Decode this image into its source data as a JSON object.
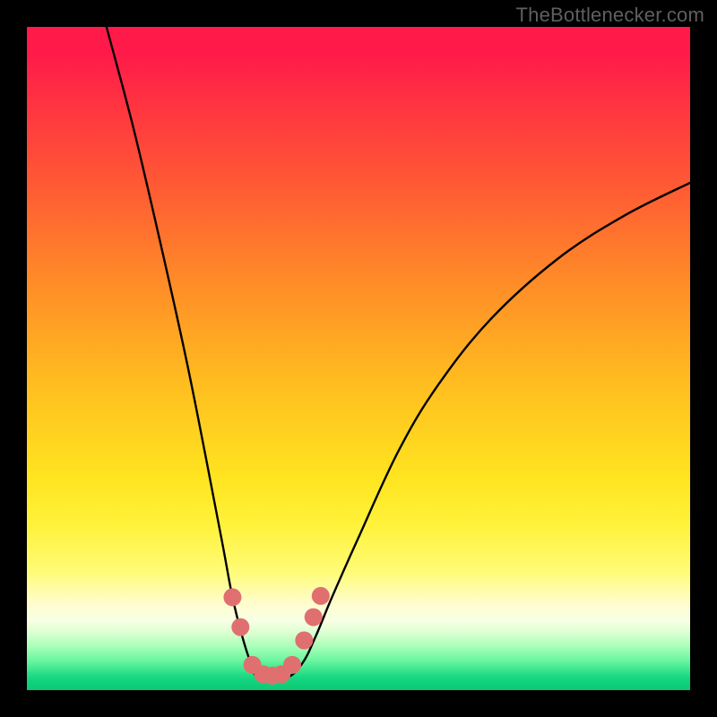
{
  "watermark": {
    "text": "TheBottlenecker.com"
  },
  "chart_data": {
    "type": "line",
    "title": "",
    "xlabel": "",
    "ylabel": "",
    "xlim": [
      0,
      100
    ],
    "ylim": [
      0,
      100
    ],
    "curve": {
      "x": [
        12,
        16,
        20,
        24,
        27,
        29.5,
        31,
        32.5,
        33.8,
        35,
        39,
        41.5,
        43.5,
        46,
        50,
        56,
        62,
        70,
        80,
        90,
        100
      ],
      "y": [
        100,
        85,
        68,
        50,
        35,
        22,
        14,
        8,
        4,
        1.8,
        1.8,
        4,
        8,
        14,
        23,
        36,
        46,
        56,
        65,
        71.5,
        76.5
      ]
    },
    "markers": [
      {
        "label": "a",
        "x": 31.0,
        "y": 14.0
      },
      {
        "label": "b",
        "x": 32.2,
        "y": 9.5
      },
      {
        "label": "c",
        "x": 34.0,
        "y": 3.8
      },
      {
        "label": "d",
        "x": 35.6,
        "y": 2.4
      },
      {
        "label": "e",
        "x": 37.0,
        "y": 2.2
      },
      {
        "label": "f",
        "x": 38.4,
        "y": 2.4
      },
      {
        "label": "g",
        "x": 40.0,
        "y": 3.8
      },
      {
        "label": "h",
        "x": 41.8,
        "y": 7.5
      },
      {
        "label": "i",
        "x": 43.2,
        "y": 11.0
      },
      {
        "label": "j",
        "x": 44.3,
        "y": 14.2
      }
    ],
    "marker_color": "#e07070",
    "marker_radius_px": 10,
    "gradient_stops": [
      {
        "pos": 0,
        "color": "#ff1a4a"
      },
      {
        "pos": 0.55,
        "color": "#ffc11f"
      },
      {
        "pos": 0.88,
        "color": "#fffdcf"
      },
      {
        "pos": 1.0,
        "color": "#0cc875"
      }
    ]
  }
}
